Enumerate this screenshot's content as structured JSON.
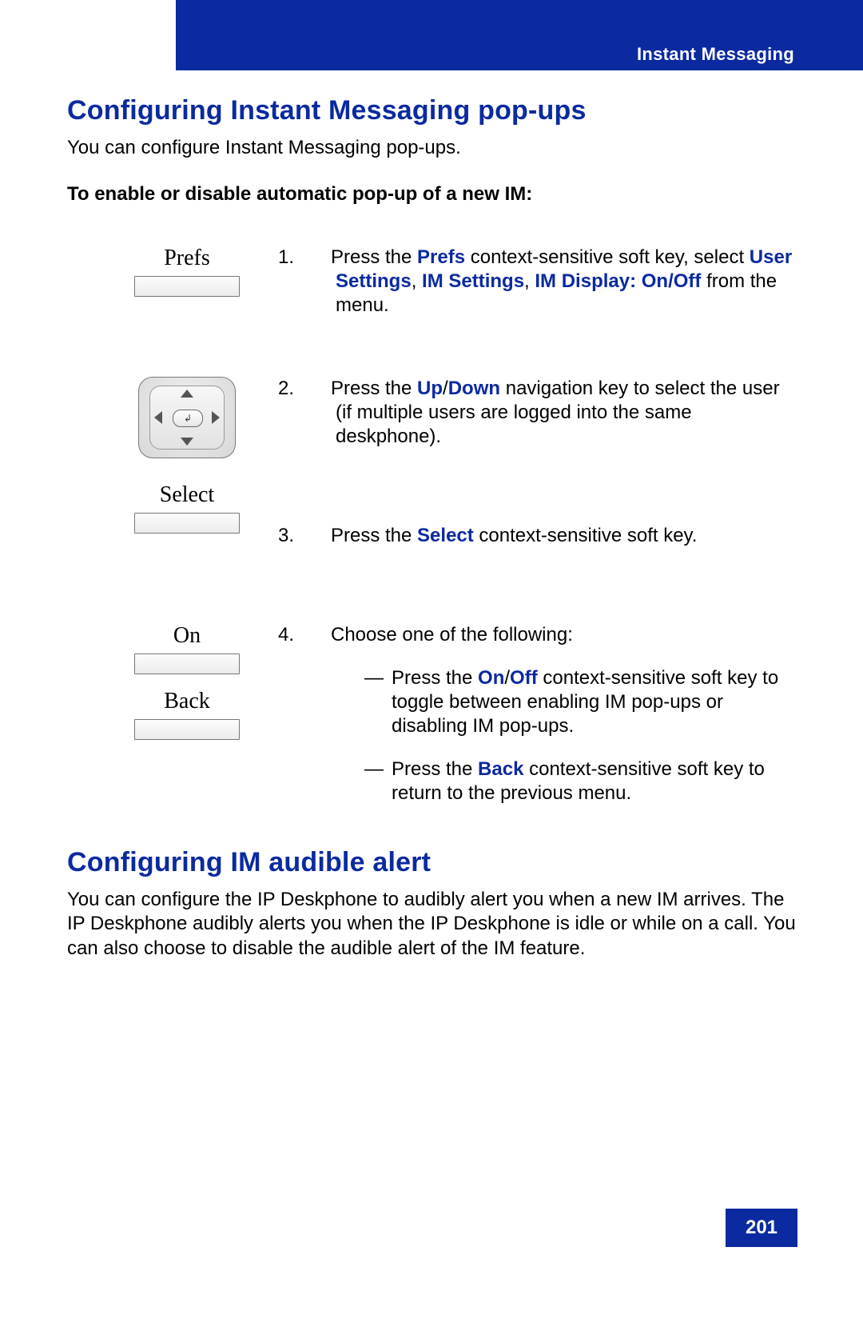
{
  "header": {
    "title": "Instant Messaging"
  },
  "section1": {
    "heading": "Configuring Instant Messaging pop-ups",
    "intro": "You can configure Instant Messaging pop-ups.",
    "subhead": "To enable or disable automatic pop-up of a new IM:"
  },
  "keys": {
    "prefs": "Prefs",
    "select": "Select",
    "on": "On",
    "back": "Back"
  },
  "steps": {
    "s1": {
      "num": "1.",
      "t1": "Press the ",
      "k1": "Prefs",
      "t2": " context-sensitive soft key, select ",
      "k2": "User Settings",
      "t3": ", ",
      "k3": "IM Settings",
      "t4": ", ",
      "k4": "IM Display: On/Off",
      "t5": " from the menu."
    },
    "s2": {
      "num": "2.",
      "t1": "Press the ",
      "k1": "Up",
      "sep": "/",
      "k2": "Down",
      "t2": " navigation key to select the user (if multiple users are logged into the same deskphone)."
    },
    "s3": {
      "num": "3.",
      "t1": "Press the ",
      "k1": "Select",
      "t2": " context-sensitive soft key."
    },
    "s4": {
      "num": "4.",
      "lead": "Choose one of the following:",
      "b1": {
        "t1": "Press the ",
        "k1": "On",
        "sep": "/",
        "k2": "Off",
        "t2": " context-sensitive soft key to toggle between enabling IM pop-ups or disabling IM pop-ups."
      },
      "b2": {
        "t1": "Press the ",
        "k1": "Back",
        "t2": " context-sensitive soft key to return to the previous menu."
      }
    }
  },
  "section2": {
    "heading": "Configuring IM audible alert",
    "body": "You can configure the IP Deskphone to audibly alert you when a new IM arrives. The IP Deskphone audibly alerts you when the IP Deskphone is idle or while on a call. You can also choose to disable the audible alert of the IM feature."
  },
  "page_number": "201"
}
